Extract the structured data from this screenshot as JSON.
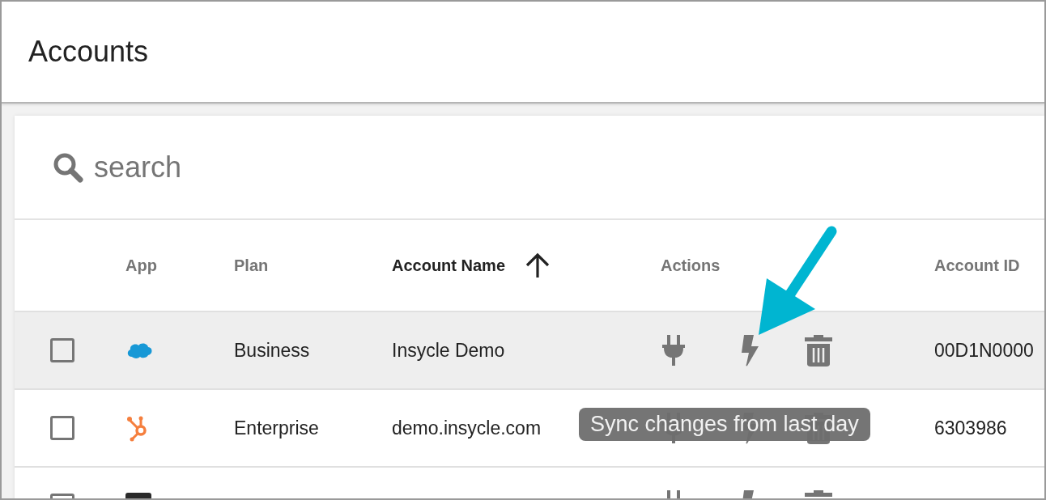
{
  "header": {
    "title": "Accounts"
  },
  "search": {
    "placeholder": "search"
  },
  "table": {
    "columns": [
      {
        "label": "App",
        "sorted": false
      },
      {
        "label": "Plan",
        "sorted": false
      },
      {
        "label": "Account Name",
        "sorted": true
      },
      {
        "label": "Actions",
        "sorted": false
      },
      {
        "label": "Account ID",
        "sorted": false
      }
    ],
    "rows": [
      {
        "checked": false,
        "highlighted": true,
        "kind": "cloud",
        "plan": "Business",
        "account_name": "Insycle Demo",
        "account_id": "00D1N0000"
      },
      {
        "checked": false,
        "highlighted": false,
        "kind": "hub",
        "plan": "Enterprise",
        "account_name": "demo.insycle.com",
        "account_id": "6303986"
      },
      {
        "highlighted": false,
        "kind": "square"
      }
    ]
  },
  "tooltip": {
    "text": "Sync changes from last day"
  }
}
